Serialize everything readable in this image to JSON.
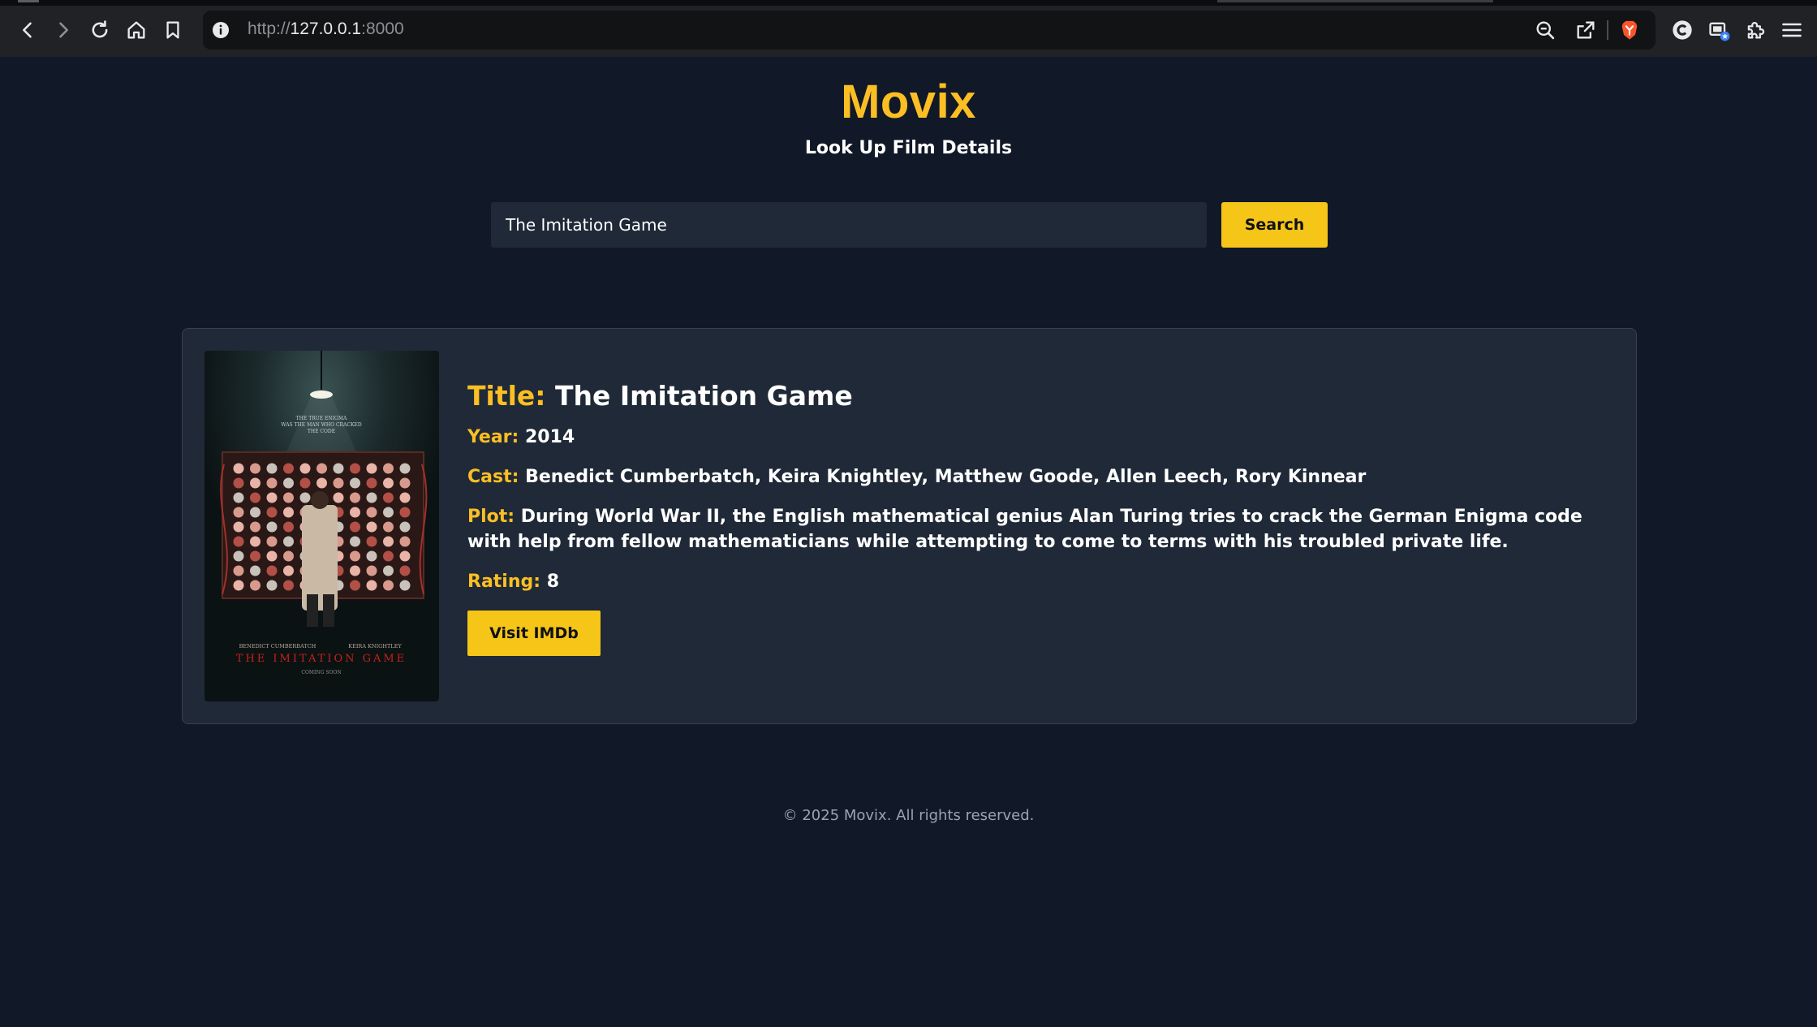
{
  "browser": {
    "url_scheme": "http://",
    "url_host": "127.0.0.1",
    "url_port": ":8000"
  },
  "header": {
    "brand": "Movix",
    "tagline": "Look Up Film Details"
  },
  "search": {
    "value": "The Imitation Game",
    "button_label": "Search"
  },
  "movie": {
    "title_label": "Title:",
    "title": "The Imitation Game",
    "year_label": "Year:",
    "year": "2014",
    "cast_label": "Cast:",
    "cast": "Benedict Cumberbatch, Keira Knightley, Matthew Goode, Allen Leech, Rory Kinnear",
    "plot_label": "Plot:",
    "plot": "During World War II, the English mathematical genius Alan Turing tries to crack the German Enigma code with help from fellow mathematicians while attempting to come to terms with his troubled private life.",
    "rating_label": "Rating:",
    "rating": "8",
    "imdb_button": "Visit IMDb",
    "poster": {
      "tagline_line1": "THE TRUE ENIGMA",
      "tagline_line2": "WAS THE MAN WHO CRACKED",
      "tagline_line3": "THE CODE",
      "actor1": "BENEDICT CUMBERBATCH",
      "actor2": "KEIRA KNIGHTLEY",
      "film_title": "THE IMITATION GAME",
      "coming_soon": "COMING SOON"
    }
  },
  "footer": {
    "text": "© 2025 Movix. All rights reserved."
  },
  "colors": {
    "accent": "#fbbf24",
    "button": "#f5c518",
    "page_bg": "#111827",
    "card_bg": "#1f2937"
  }
}
